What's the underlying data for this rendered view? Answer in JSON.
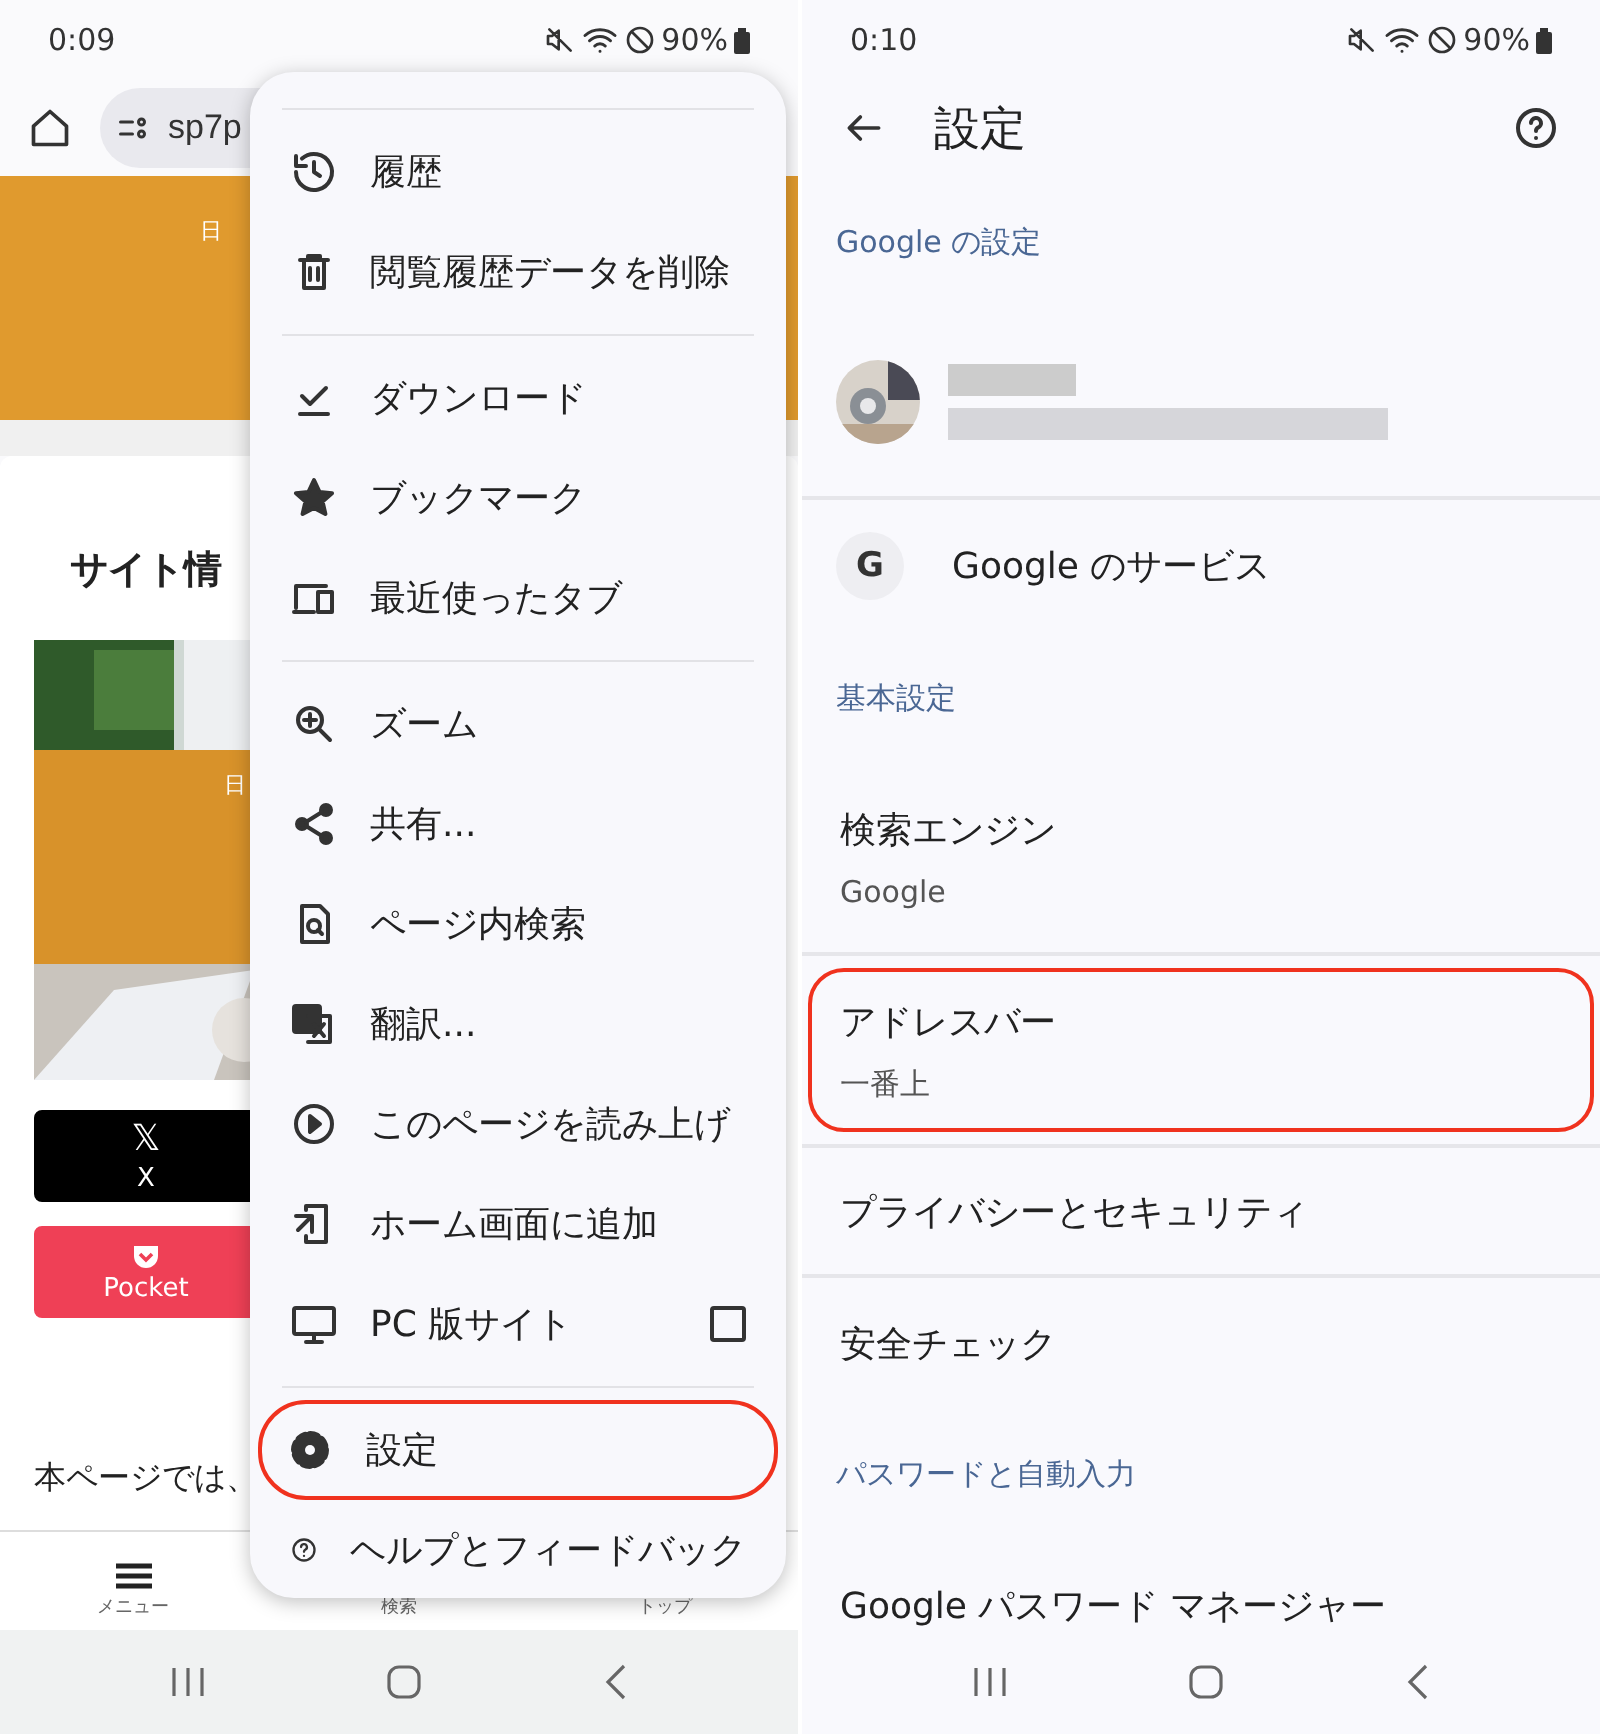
{
  "left_screen": {
    "status_bar": {
      "time": "0:09",
      "battery": "90%"
    },
    "toolbar": {
      "url": "sp7p"
    },
    "page": {
      "banner_text": "日",
      "heading": "サイト情",
      "image_text": "日",
      "share_buttons": [
        {
          "kind": "x",
          "logo": "𝕏",
          "label": "X"
        },
        {
          "kind": "pocket",
          "label": "Pocket"
        }
      ],
      "body_text": "本ページでは、"
    },
    "bottom_nav": [
      {
        "kind": "menu",
        "label": "メニュー"
      },
      {
        "kind": "search",
        "label": "検索"
      },
      {
        "kind": "top",
        "label": "トップ"
      }
    ],
    "menu": {
      "groups": [
        [
          {
            "kind": "history",
            "label": "履歴"
          },
          {
            "kind": "trash",
            "label": "閲覧履歴データを削除"
          }
        ],
        [
          {
            "kind": "download",
            "label": "ダウンロード"
          },
          {
            "kind": "star",
            "label": "ブックマーク"
          },
          {
            "kind": "devices",
            "label": "最近使ったタブ"
          }
        ],
        [
          {
            "kind": "zoom",
            "label": "ズーム"
          },
          {
            "kind": "share",
            "label": "共有..."
          },
          {
            "kind": "find",
            "label": "ページ内検索"
          },
          {
            "kind": "translate",
            "label": "翻訳..."
          },
          {
            "kind": "play",
            "label": "このページを読み上げ"
          },
          {
            "kind": "addhome",
            "label": "ホーム画面に追加"
          },
          {
            "kind": "desktop",
            "label": "PC 版サイト",
            "checked": false
          }
        ],
        [
          {
            "kind": "gear",
            "label": "設定",
            "highlighted": true
          },
          {
            "kind": "help",
            "label": "ヘルプとフィードバック"
          }
        ]
      ]
    }
  },
  "right_screen": {
    "status_bar": {
      "time": "0:10",
      "battery": "90%"
    },
    "header": {
      "title": "設定"
    },
    "items": [
      {
        "kind": "section",
        "label": "Google の設定"
      },
      {
        "kind": "account",
        "divider": true
      },
      {
        "kind": "service",
        "label": "Google のサービス",
        "icon_letter": "G"
      },
      {
        "kind": "section",
        "label": "基本設定"
      },
      {
        "kind": "setting",
        "label": "検索エンジン",
        "value": "Google",
        "divider": true
      },
      {
        "kind": "setting",
        "label": "アドレスバー",
        "value": "一番上",
        "highlighted": true,
        "divider": true
      },
      {
        "kind": "setting",
        "label": "プライバシーとセキュリティ",
        "divider": true
      },
      {
        "kind": "setting",
        "label": "安全チェック"
      },
      {
        "kind": "section",
        "label": "パスワードと自動入力"
      },
      {
        "kind": "setting",
        "label": "Google パスワード マネージャー"
      }
    ]
  }
}
